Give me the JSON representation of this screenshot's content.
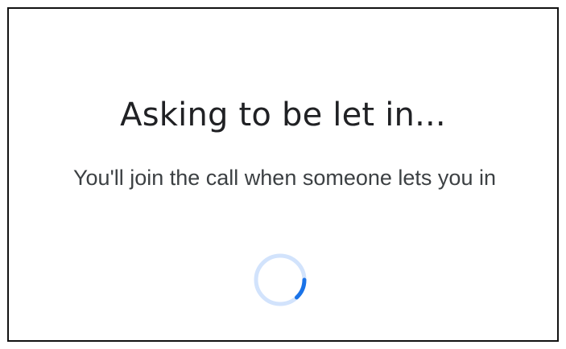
{
  "dialog": {
    "title": "Asking to be let in...",
    "message": "You'll join the call when someone lets you in"
  },
  "spinner": {
    "icon": "loading-spinner-icon",
    "track_color": "#d2e3fc",
    "arc_color": "#1a73e8"
  }
}
